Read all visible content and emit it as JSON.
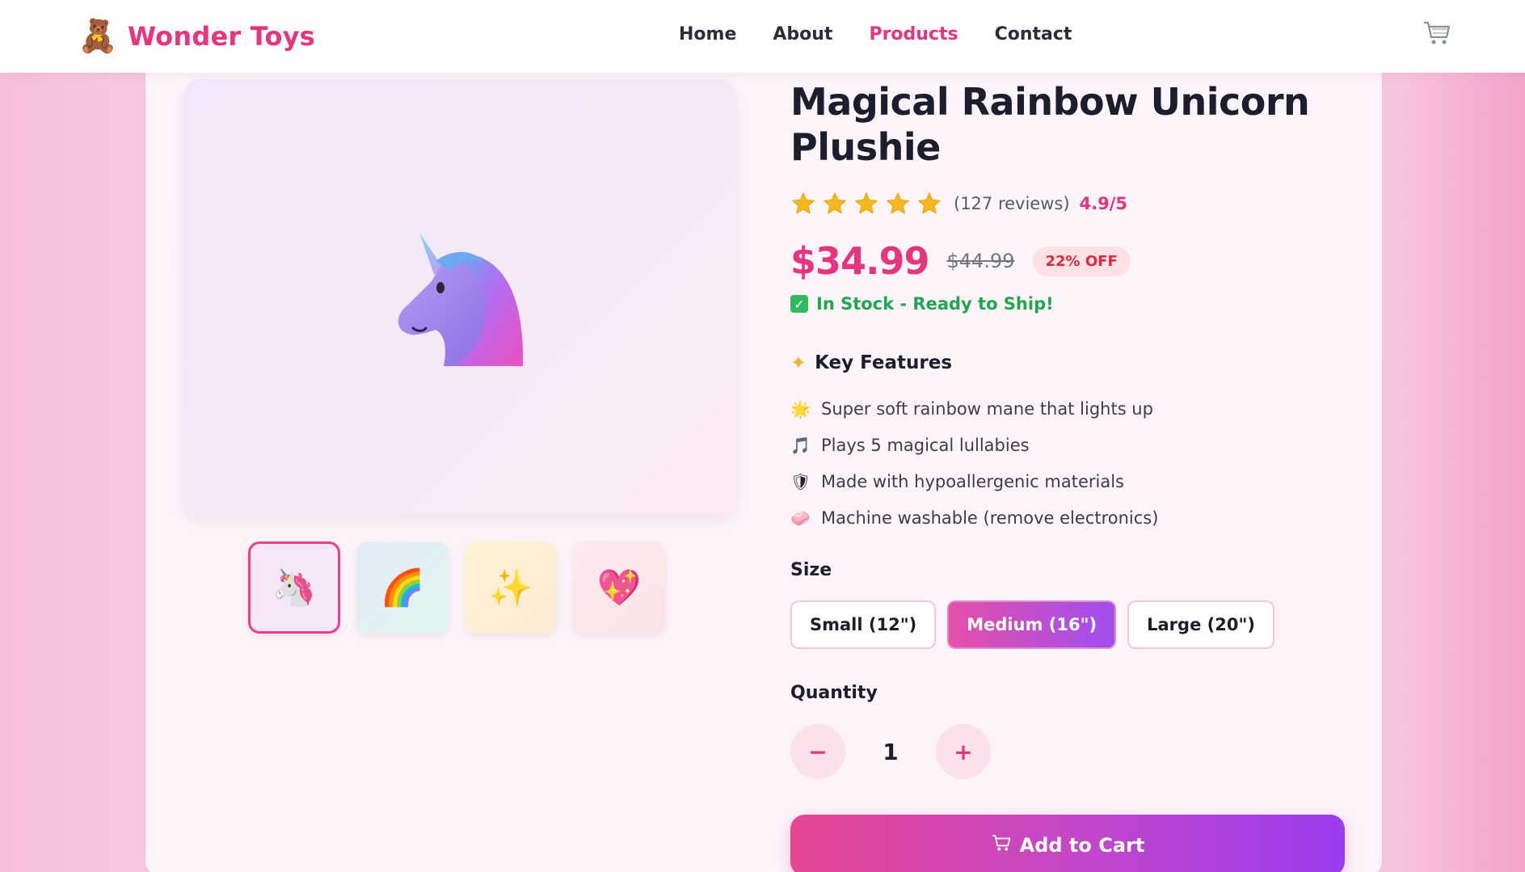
{
  "header": {
    "brand": "Wonder Toys",
    "logo_icon": "🧸",
    "nav": [
      {
        "label": "Home",
        "active": false
      },
      {
        "label": "About",
        "active": false
      },
      {
        "label": "Products",
        "active": true
      },
      {
        "label": "Contact",
        "active": false
      }
    ],
    "cart_icon": "🛒"
  },
  "gallery": {
    "main_icon": "unicorn-icon",
    "thumbnails": [
      {
        "icon": "🦄",
        "selected": true
      },
      {
        "icon": "🌈",
        "selected": false
      },
      {
        "icon": "✨",
        "selected": false
      },
      {
        "icon": "💖",
        "selected": false
      }
    ]
  },
  "product": {
    "title_line1": "Magical Rainbow Unicorn",
    "title_line2": "Plushie",
    "rating_stars": 5,
    "reviews": "(127 reviews)",
    "score": "4.9/5",
    "price": "$34.99",
    "old_price": "$44.99",
    "discount": "22% OFF",
    "stock": "In Stock - Ready to Ship!",
    "features_title": "Key Features",
    "features": [
      {
        "icon": "🌟",
        "text": "Super soft rainbow mane that lights up"
      },
      {
        "icon": "🎵",
        "text": "Plays 5 magical lullabies"
      },
      {
        "icon": "🛡",
        "text": "Made with hypoallergenic materials"
      },
      {
        "icon": "🧼",
        "text": "Machine washable (remove electronics)"
      }
    ],
    "size_label": "Size",
    "sizes": [
      {
        "label": "Small (12\")",
        "selected": false
      },
      {
        "label": "Medium (16\")",
        "selected": true
      },
      {
        "label": "Large (20\")",
        "selected": false
      }
    ],
    "quantity_label": "Quantity",
    "quantity": "1",
    "minus": "−",
    "plus": "+",
    "add_to_cart": "Add to Cart"
  },
  "colors": {
    "accent": "#e6347f",
    "stock_green": "#1fa64f",
    "discount_red": "#e3283a",
    "cta_start": "#e74592",
    "cta_end": "#9a3cf0"
  }
}
